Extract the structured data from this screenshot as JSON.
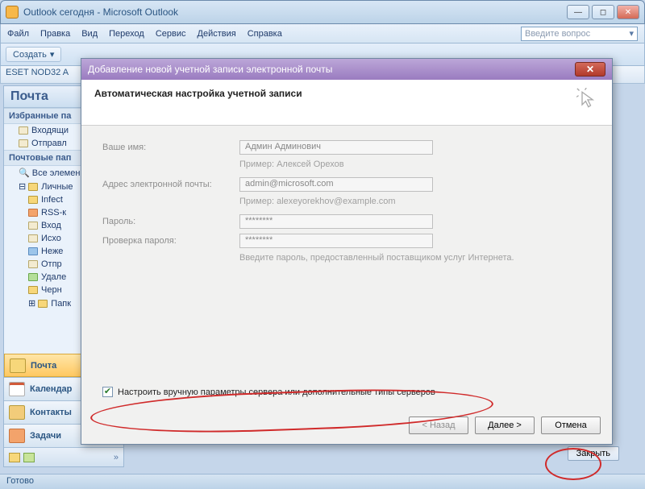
{
  "window": {
    "title": "Outlook сегодня - Microsoft Outlook"
  },
  "menu": {
    "file": "Файл",
    "edit": "Правка",
    "view": "Вид",
    "go": "Переход",
    "tools": "Сервис",
    "actions": "Действия",
    "help": "Справка",
    "ask": "Введите вопрос"
  },
  "toolbar": {
    "create": "Создать"
  },
  "nod": "ESET NOD32 A",
  "nav": {
    "head": "Почта",
    "fav": "Избранные па",
    "inbox": "Входящи",
    "sent": "Отправл",
    "folders": "Почтовые пап",
    "all": "Все элемен",
    "personal": "Личные",
    "infect": "Infect",
    "rss": "RSS-к",
    "in2": "Вход",
    "out": "Исхо",
    "junk": "Неже",
    "sent2": "Отпр",
    "del": "Удале",
    "drafts": "Черн",
    "search": "Папк",
    "btn_mail": "Почта",
    "btn_cal": "Календар",
    "btn_con": "Контакты",
    "btn_task": "Задачи"
  },
  "right": {
    "close": "Закрыть"
  },
  "status": "Готово",
  "dialog": {
    "title": "Добавление новой учетной записи электронной почты",
    "heading": "Автоматическая настройка учетной записи",
    "name_label": "Ваше имя:",
    "name_value": "Админ Админович",
    "name_example": "Пример: Алексей Орехов",
    "email_label": "Адрес электронной почты:",
    "email_value": "admin@microsoft.com",
    "email_example": "Пример: alexeyorekhov@example.com",
    "pwd_label": "Пароль:",
    "pwd_value": "********",
    "pwd2_label": "Проверка пароля:",
    "pwd2_value": "********",
    "pwd_note": "Введите пароль, предоставленный поставщиком услуг Интернета.",
    "manual": "Настроить вручную параметры сервера или дополнительные типы серверов",
    "back": "< Назад",
    "next": "Далее >",
    "cancel": "Отмена"
  }
}
